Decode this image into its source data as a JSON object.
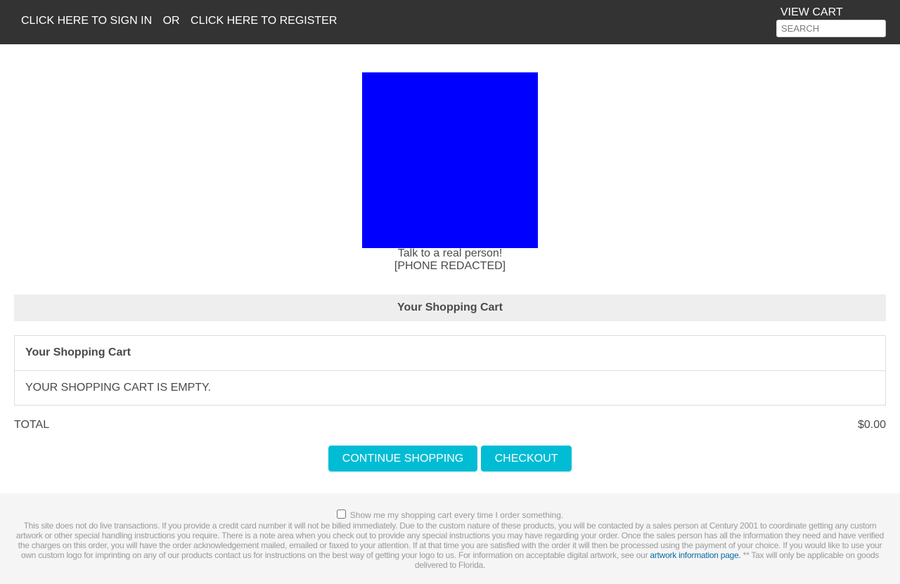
{
  "header": {
    "sign_in": "CLICK HERE TO SIGN IN",
    "or": "OR",
    "register": "CLICK HERE TO REGISTER",
    "view_cart": "VIEW CART",
    "search_placeholder": "SEARCH"
  },
  "promo": {
    "image_color": "#0000ff",
    "line1": "Talk to a real person!",
    "line2": "[PHONE REDACTED]"
  },
  "cart": {
    "band_title": "Your Shopping Cart",
    "table_header": "Your Shopping Cart",
    "empty_message": "YOUR SHOPPING CART IS EMPTY.",
    "total_label": "TOTAL",
    "total_value": "$0.00",
    "continue_label": "CONTINUE SHOPPING",
    "checkout_label": "CHECKOUT"
  },
  "footer": {
    "checkbox_label": "Show me my shopping cart every time I order something.",
    "disclaimer": "This site does not do live transactions. If you provide a credit card number it will not be billed immediately. Due to the custom nature of these products, you will be contacted by a sales person at Century 2001 to coordinate getting any custom artwork or other special handling instructions you require. There is a note area when you check out to provide any special instructions you may have regarding your order. Once the sales person has all the information they need and have verified the charges on this order, you will have the order acknowledgement mailed, emailed or faxed to your attention. If at that time you are satisfied with the order it will then be processed using the payment of your choice. If you would like to use your own custom logo for imprinting on any of our products contact us for instructions on the best way of getting your logo to us. For information on acceptable digital artwork, see our",
    "link_text": "artwork information page.",
    "tax_note": "** Tax will only be applicable on goods delivered to Florida."
  },
  "colors": {
    "topbar": "#333333",
    "accent_button": "#00bcd4",
    "footer_bg": "#f5f5f5",
    "link": "#0b6aa0"
  }
}
